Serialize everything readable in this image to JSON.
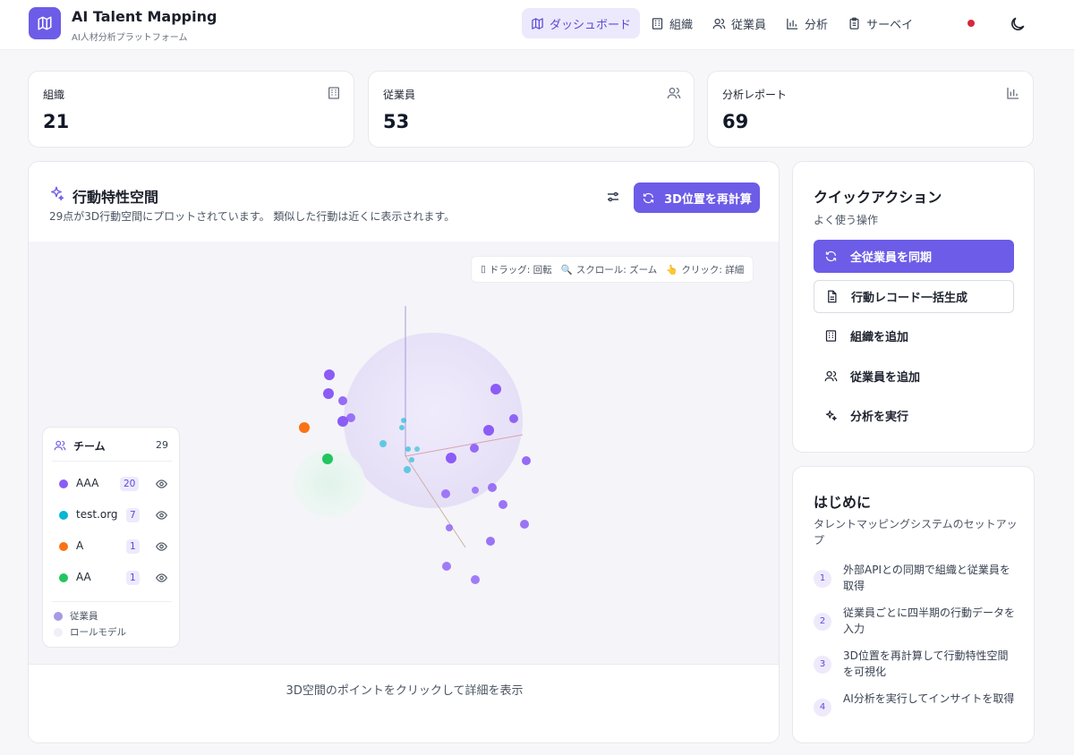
{
  "app": {
    "title": "AI Talent Mapping",
    "subtitle": "AI人材分析プラットフォーム"
  },
  "nav": [
    {
      "label": "ダッシュボード",
      "icon": "map-icon",
      "active": true
    },
    {
      "label": "組織",
      "icon": "building-icon",
      "active": false
    },
    {
      "label": "従業員",
      "icon": "users-icon",
      "active": false
    },
    {
      "label": "分析",
      "icon": "bar-chart-icon",
      "active": false
    },
    {
      "label": "サーベイ",
      "icon": "clipboard-icon",
      "active": false
    }
  ],
  "stats": [
    {
      "label": "組織",
      "value": "21",
      "icon": "building-icon"
    },
    {
      "label": "従業員",
      "value": "53",
      "icon": "users-icon"
    },
    {
      "label": "分析レポート",
      "value": "69",
      "icon": "bar-chart-icon"
    }
  ],
  "panel": {
    "title": "行動特性空間",
    "subtitle": "29点が3D行動空間にプロットされています。 類似した行動は近くに表示されます。",
    "recalc_label": "3D位置を再計算",
    "hint": {
      "drag": "ドラッグ: 回転",
      "scroll": "スクロール: ズーム",
      "click": "クリック: 詳細"
    },
    "footer": "3D空間のポイントをクリックして詳細を表示"
  },
  "legend": {
    "title": "チーム",
    "total": "29",
    "teams": [
      {
        "name": "AAA",
        "count": "20",
        "color": "#8b5cf6"
      },
      {
        "name": "test.org",
        "count": "7",
        "color": "#06b6d4"
      },
      {
        "name": "A",
        "count": "1",
        "color": "#f97316"
      },
      {
        "name": "AA",
        "count": "1",
        "color": "#22c55e"
      }
    ],
    "employee_label": "従業員",
    "role_model_label": "ロールモデル"
  },
  "quick_actions": {
    "title": "クイックアクション",
    "subtitle": "よく使う操作",
    "items": [
      {
        "label": "全従業員を同期",
        "icon": "refresh-icon",
        "style": "primary"
      },
      {
        "label": "行動レコード一括生成",
        "icon": "document-icon",
        "style": "outline"
      },
      {
        "label": "組織を追加",
        "icon": "building-icon",
        "style": "plain"
      },
      {
        "label": "従業員を追加",
        "icon": "users-icon",
        "style": "plain"
      },
      {
        "label": "分析を実行",
        "icon": "sparkles-icon",
        "style": "plain"
      }
    ]
  },
  "getting_started": {
    "title": "はじめに",
    "subtitle": "タレントマッピングシステムのセットアップ",
    "steps": [
      {
        "num": "1",
        "text": "外部APIとの同期で組織と従業員を取得"
      },
      {
        "num": "2",
        "text": "従業員ごとに四半期の行動データを入力"
      },
      {
        "num": "3",
        "text": "3D位置を再計算して行動特性空間を可視化"
      },
      {
        "num": "4",
        "text": "AI分析を実行してインサイトを取得"
      }
    ]
  },
  "colors": {
    "accent": "#6c5ce7",
    "accent_light": "#ece9fc"
  }
}
